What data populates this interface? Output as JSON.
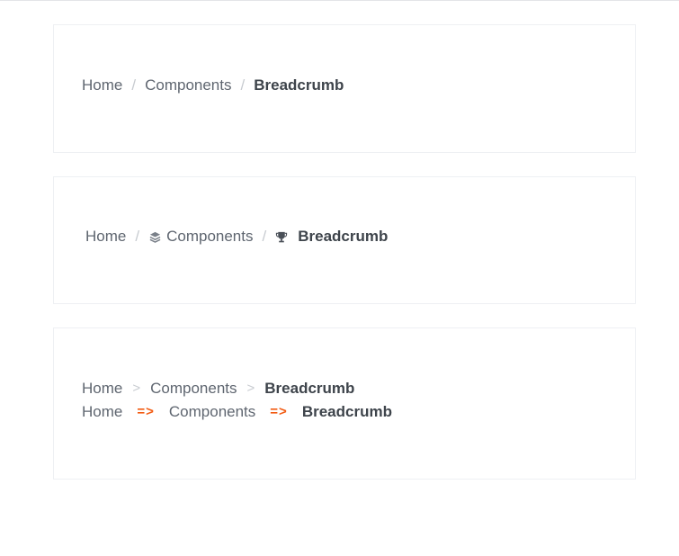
{
  "cards": [
    {
      "items": [
        "Home",
        "Components",
        "Breadcrumb"
      ],
      "separator": "/"
    },
    {
      "items": [
        "Home",
        "Components",
        "Breadcrumb"
      ],
      "separator": "/",
      "icons": [
        "layers-icon",
        "trophy-icon"
      ]
    },
    {
      "rows": [
        {
          "items": [
            "Home",
            "Components",
            "Breadcrumb"
          ],
          "separator": ">"
        },
        {
          "items": [
            "Home",
            "Components",
            "Breadcrumb"
          ],
          "separator": "=>"
        }
      ]
    }
  ],
  "colors": {
    "text": "#5f6670",
    "active": "#3e444b",
    "separator": "#c7cbd0",
    "arrow": "#f25c14"
  }
}
